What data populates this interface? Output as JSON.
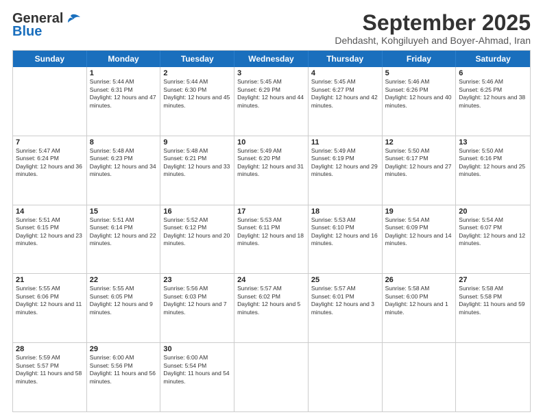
{
  "header": {
    "logo_general": "General",
    "logo_blue": "Blue",
    "month_title": "September 2025",
    "subtitle": "Dehdasht, Kohgiluyeh and Boyer-Ahmad, Iran"
  },
  "days_of_week": [
    "Sunday",
    "Monday",
    "Tuesday",
    "Wednesday",
    "Thursday",
    "Friday",
    "Saturday"
  ],
  "weeks": [
    [
      {
        "day": "",
        "sunrise": "",
        "sunset": "",
        "daylight": ""
      },
      {
        "day": "1",
        "sunrise": "Sunrise: 5:44 AM",
        "sunset": "Sunset: 6:31 PM",
        "daylight": "Daylight: 12 hours and 47 minutes."
      },
      {
        "day": "2",
        "sunrise": "Sunrise: 5:44 AM",
        "sunset": "Sunset: 6:30 PM",
        "daylight": "Daylight: 12 hours and 45 minutes."
      },
      {
        "day": "3",
        "sunrise": "Sunrise: 5:45 AM",
        "sunset": "Sunset: 6:29 PM",
        "daylight": "Daylight: 12 hours and 44 minutes."
      },
      {
        "day": "4",
        "sunrise": "Sunrise: 5:45 AM",
        "sunset": "Sunset: 6:27 PM",
        "daylight": "Daylight: 12 hours and 42 minutes."
      },
      {
        "day": "5",
        "sunrise": "Sunrise: 5:46 AM",
        "sunset": "Sunset: 6:26 PM",
        "daylight": "Daylight: 12 hours and 40 minutes."
      },
      {
        "day": "6",
        "sunrise": "Sunrise: 5:46 AM",
        "sunset": "Sunset: 6:25 PM",
        "daylight": "Daylight: 12 hours and 38 minutes."
      }
    ],
    [
      {
        "day": "7",
        "sunrise": "Sunrise: 5:47 AM",
        "sunset": "Sunset: 6:24 PM",
        "daylight": "Daylight: 12 hours and 36 minutes."
      },
      {
        "day": "8",
        "sunrise": "Sunrise: 5:48 AM",
        "sunset": "Sunset: 6:23 PM",
        "daylight": "Daylight: 12 hours and 34 minutes."
      },
      {
        "day": "9",
        "sunrise": "Sunrise: 5:48 AM",
        "sunset": "Sunset: 6:21 PM",
        "daylight": "Daylight: 12 hours and 33 minutes."
      },
      {
        "day": "10",
        "sunrise": "Sunrise: 5:49 AM",
        "sunset": "Sunset: 6:20 PM",
        "daylight": "Daylight: 12 hours and 31 minutes."
      },
      {
        "day": "11",
        "sunrise": "Sunrise: 5:49 AM",
        "sunset": "Sunset: 6:19 PM",
        "daylight": "Daylight: 12 hours and 29 minutes."
      },
      {
        "day": "12",
        "sunrise": "Sunrise: 5:50 AM",
        "sunset": "Sunset: 6:17 PM",
        "daylight": "Daylight: 12 hours and 27 minutes."
      },
      {
        "day": "13",
        "sunrise": "Sunrise: 5:50 AM",
        "sunset": "Sunset: 6:16 PM",
        "daylight": "Daylight: 12 hours and 25 minutes."
      }
    ],
    [
      {
        "day": "14",
        "sunrise": "Sunrise: 5:51 AM",
        "sunset": "Sunset: 6:15 PM",
        "daylight": "Daylight: 12 hours and 23 minutes."
      },
      {
        "day": "15",
        "sunrise": "Sunrise: 5:51 AM",
        "sunset": "Sunset: 6:14 PM",
        "daylight": "Daylight: 12 hours and 22 minutes."
      },
      {
        "day": "16",
        "sunrise": "Sunrise: 5:52 AM",
        "sunset": "Sunset: 6:12 PM",
        "daylight": "Daylight: 12 hours and 20 minutes."
      },
      {
        "day": "17",
        "sunrise": "Sunrise: 5:53 AM",
        "sunset": "Sunset: 6:11 PM",
        "daylight": "Daylight: 12 hours and 18 minutes."
      },
      {
        "day": "18",
        "sunrise": "Sunrise: 5:53 AM",
        "sunset": "Sunset: 6:10 PM",
        "daylight": "Daylight: 12 hours and 16 minutes."
      },
      {
        "day": "19",
        "sunrise": "Sunrise: 5:54 AM",
        "sunset": "Sunset: 6:09 PM",
        "daylight": "Daylight: 12 hours and 14 minutes."
      },
      {
        "day": "20",
        "sunrise": "Sunrise: 5:54 AM",
        "sunset": "Sunset: 6:07 PM",
        "daylight": "Daylight: 12 hours and 12 minutes."
      }
    ],
    [
      {
        "day": "21",
        "sunrise": "Sunrise: 5:55 AM",
        "sunset": "Sunset: 6:06 PM",
        "daylight": "Daylight: 12 hours and 11 minutes."
      },
      {
        "day": "22",
        "sunrise": "Sunrise: 5:55 AM",
        "sunset": "Sunset: 6:05 PM",
        "daylight": "Daylight: 12 hours and 9 minutes."
      },
      {
        "day": "23",
        "sunrise": "Sunrise: 5:56 AM",
        "sunset": "Sunset: 6:03 PM",
        "daylight": "Daylight: 12 hours and 7 minutes."
      },
      {
        "day": "24",
        "sunrise": "Sunrise: 5:57 AM",
        "sunset": "Sunset: 6:02 PM",
        "daylight": "Daylight: 12 hours and 5 minutes."
      },
      {
        "day": "25",
        "sunrise": "Sunrise: 5:57 AM",
        "sunset": "Sunset: 6:01 PM",
        "daylight": "Daylight: 12 hours and 3 minutes."
      },
      {
        "day": "26",
        "sunrise": "Sunrise: 5:58 AM",
        "sunset": "Sunset: 6:00 PM",
        "daylight": "Daylight: 12 hours and 1 minute."
      },
      {
        "day": "27",
        "sunrise": "Sunrise: 5:58 AM",
        "sunset": "Sunset: 5:58 PM",
        "daylight": "Daylight: 11 hours and 59 minutes."
      }
    ],
    [
      {
        "day": "28",
        "sunrise": "Sunrise: 5:59 AM",
        "sunset": "Sunset: 5:57 PM",
        "daylight": "Daylight: 11 hours and 58 minutes."
      },
      {
        "day": "29",
        "sunrise": "Sunrise: 6:00 AM",
        "sunset": "Sunset: 5:56 PM",
        "daylight": "Daylight: 11 hours and 56 minutes."
      },
      {
        "day": "30",
        "sunrise": "Sunrise: 6:00 AM",
        "sunset": "Sunset: 5:54 PM",
        "daylight": "Daylight: 11 hours and 54 minutes."
      },
      {
        "day": "",
        "sunrise": "",
        "sunset": "",
        "daylight": ""
      },
      {
        "day": "",
        "sunrise": "",
        "sunset": "",
        "daylight": ""
      },
      {
        "day": "",
        "sunrise": "",
        "sunset": "",
        "daylight": ""
      },
      {
        "day": "",
        "sunrise": "",
        "sunset": "",
        "daylight": ""
      }
    ]
  ]
}
